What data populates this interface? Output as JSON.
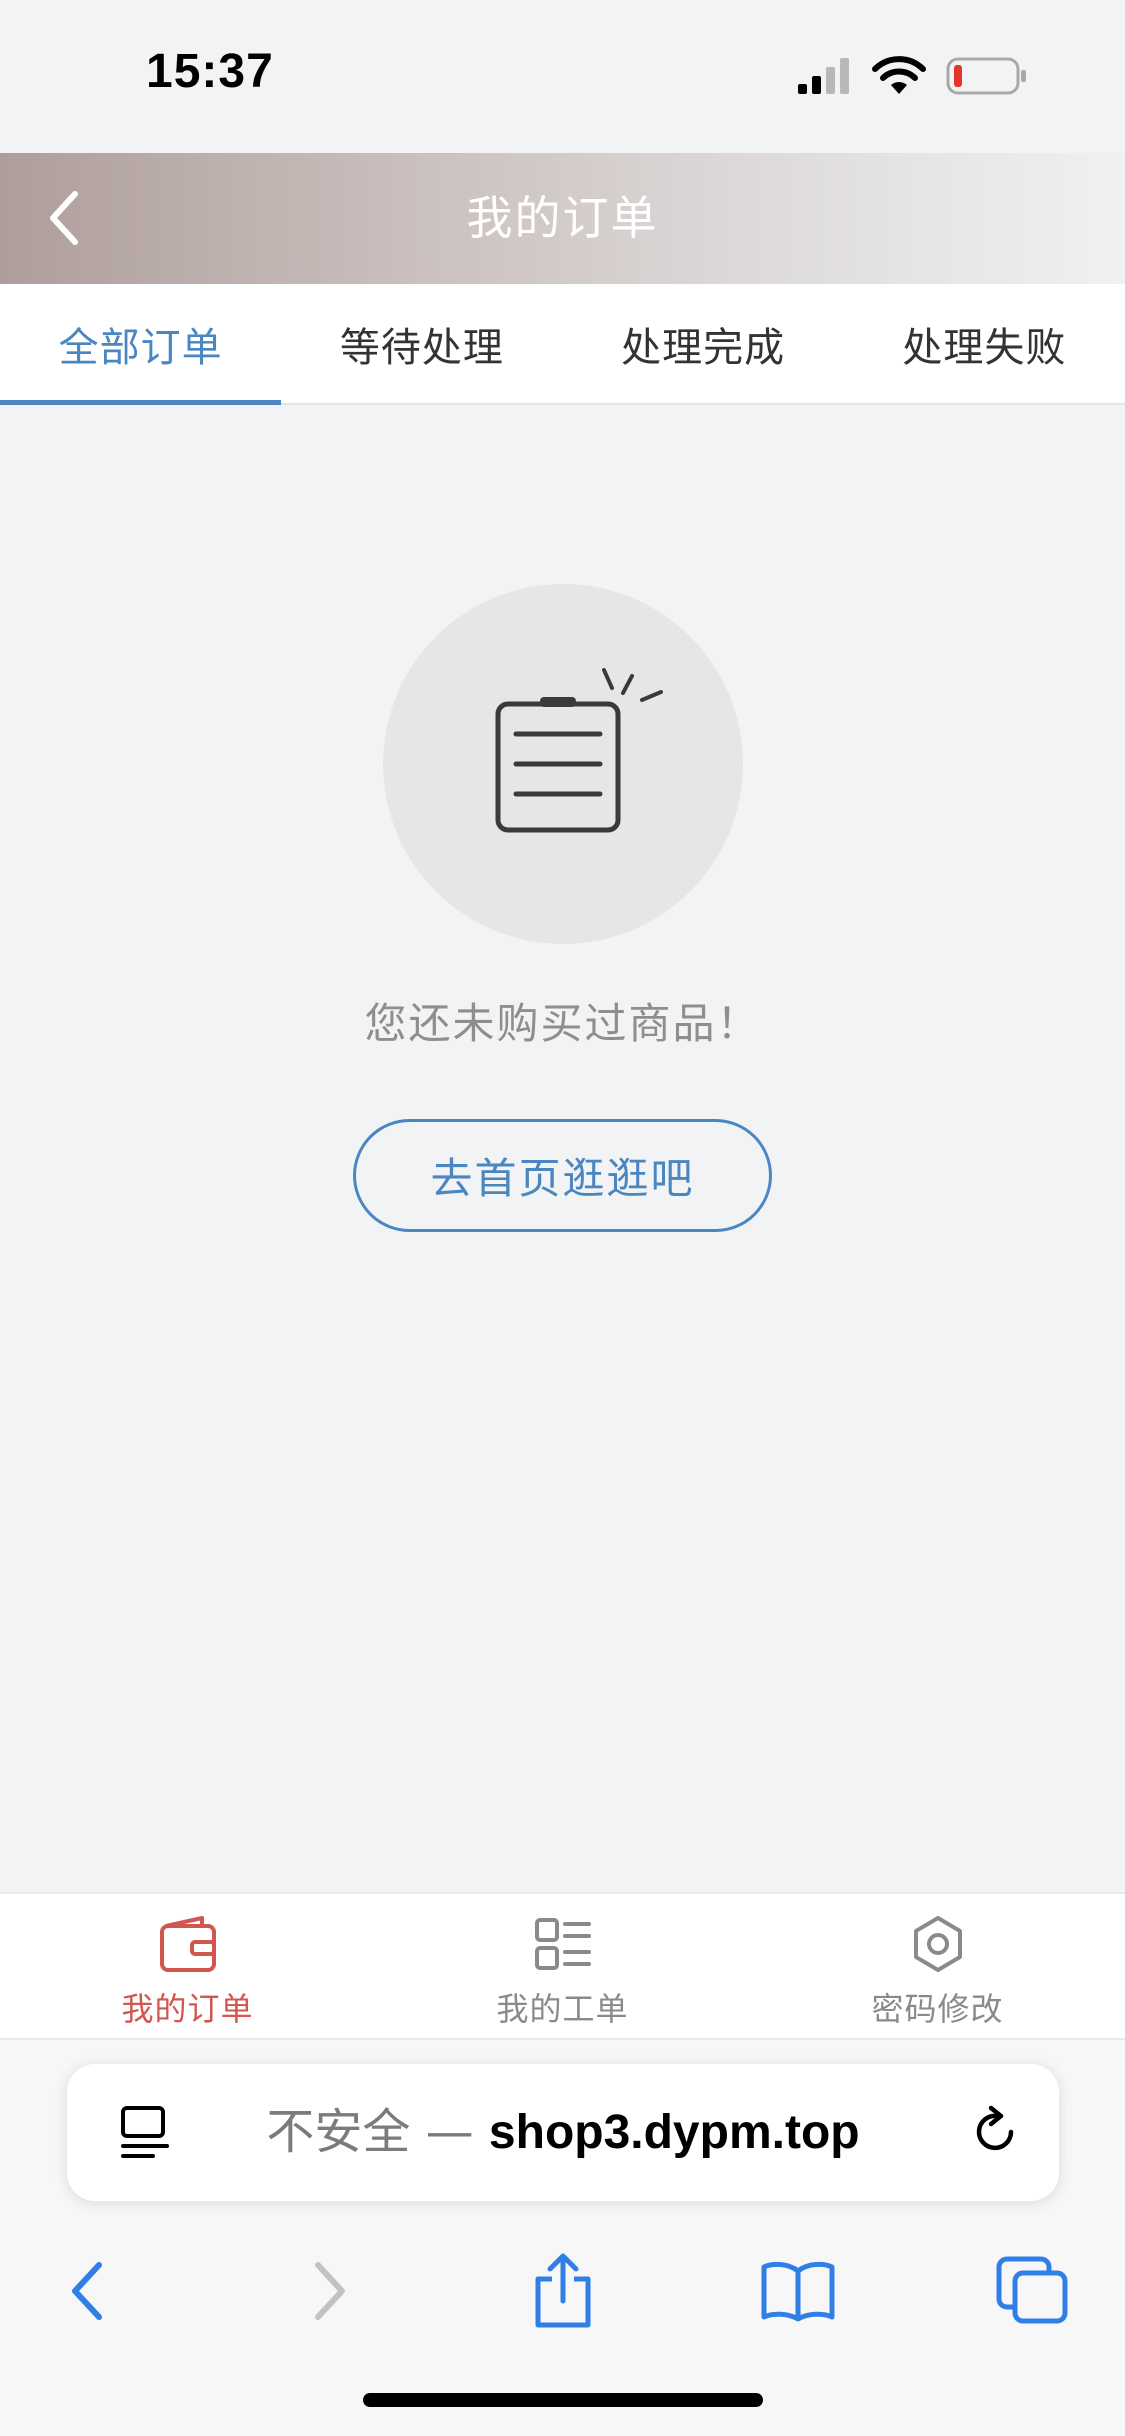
{
  "status_bar": {
    "time": "15:37"
  },
  "header": {
    "title": "我的订单"
  },
  "tabs": [
    {
      "label": "全部订单",
      "active": true
    },
    {
      "label": "等待处理",
      "active": false
    },
    {
      "label": "处理完成",
      "active": false
    },
    {
      "label": "处理失败",
      "active": false
    }
  ],
  "empty_state": {
    "icon": "clipboard-list-icon",
    "message": "您还未购买过商品！",
    "button_label": "去首页逛逛吧"
  },
  "bottom_nav": [
    {
      "label": "我的订单",
      "icon": "wallet-icon",
      "active": true
    },
    {
      "label": "我的工单",
      "icon": "grid-list-icon",
      "active": false
    },
    {
      "label": "密码修改",
      "icon": "gear-icon",
      "active": false
    }
  ],
  "browser": {
    "address_prefix": "不安全 — ",
    "address_host": "shop3.dypm.top"
  },
  "colors": {
    "accent": "#4a86c0",
    "active_nav": "#d2554e",
    "ios_blue": "#2f7fe6"
  }
}
